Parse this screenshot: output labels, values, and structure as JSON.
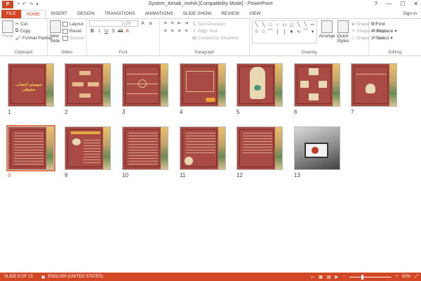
{
  "window": {
    "title": "System_Aesab_mohiti  [Compatibility Mode] - PowerPoint",
    "app_icon": "P",
    "controls": [
      "?",
      "—",
      "☐",
      "✕"
    ]
  },
  "tabs": [
    "FILE",
    "HOME",
    "INSERT",
    "DESIGN",
    "TRANSITIONS",
    "ANIMATIONS",
    "SLIDE SHOW",
    "REVIEW",
    "VIEW"
  ],
  "active_tab": "HOME",
  "sign_in": "Sign in",
  "ribbon": {
    "clipboard": {
      "paste": "Paste",
      "cut": "Cut",
      "copy": "Copy",
      "format_painter": "Format Painter",
      "label": "Clipboard"
    },
    "slides": {
      "new_slide": "New Slide",
      "layout": "Layout",
      "reset": "Reset",
      "section": "Section",
      "label": "Slides"
    },
    "font": {
      "size": "20",
      "label": "Font"
    },
    "paragraph": {
      "text_direction": "Text Direction",
      "align_text": "Align Text",
      "convert_smartart": "Convert to SmartArt",
      "label": "Paragraph"
    },
    "drawing": {
      "arrange": "Arrange",
      "quick_styles": "Quick Styles",
      "shape_fill": "Shape Fill",
      "shape_outline": "Shape Outline",
      "shape_effects": "Shape Effects",
      "label": "Drawing"
    },
    "editing": {
      "find": "Find",
      "replace": "Replace",
      "select": "Select",
      "label": "Editing"
    }
  },
  "slides": [
    {
      "num": "1",
      "title_text": "سیستم اعصاب محیطی"
    },
    {
      "num": "2"
    },
    {
      "num": "3"
    },
    {
      "num": "4"
    },
    {
      "num": "5"
    },
    {
      "num": "6"
    },
    {
      "num": "7"
    },
    {
      "num": "8"
    },
    {
      "num": "9"
    },
    {
      "num": "10"
    },
    {
      "num": "11"
    },
    {
      "num": "12"
    },
    {
      "num": "13"
    }
  ],
  "selected_slide": "8",
  "status": {
    "slide": "SLIDE 8 OF 13",
    "language": "ENGLISH (UNITED STATES)",
    "zoom": "62%",
    "zoom_fraction": 0.62
  },
  "colors": {
    "accent": "#d24726",
    "slide_bg": "#a94a45",
    "selection": "#e87a48"
  }
}
